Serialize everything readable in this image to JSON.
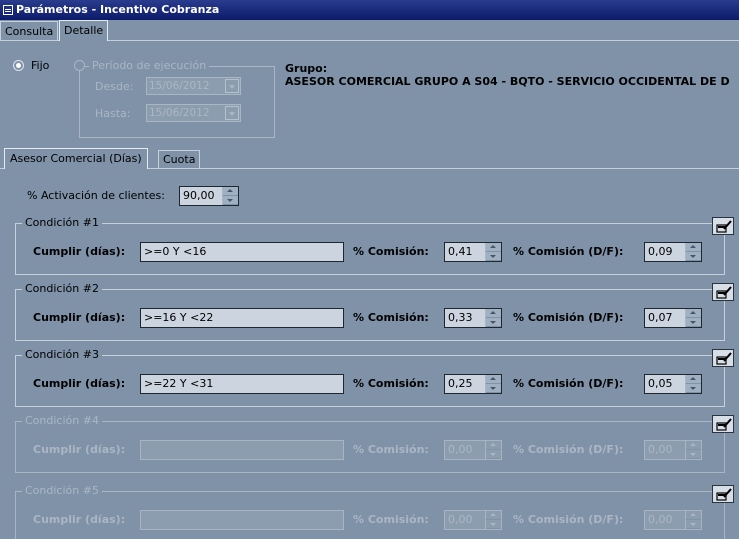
{
  "window": {
    "title": "Parámetros - Incentivo Cobranza"
  },
  "tabs": [
    {
      "label": "Consulta"
    },
    {
      "label": "Detalle"
    }
  ],
  "header": {
    "fijo_label": "Fijo",
    "periodo_label": "Período de ejecución",
    "desde_label": "Desde:",
    "desde_value": "15/06/2012",
    "hasta_label": "Hasta:",
    "hasta_value": "15/06/2012",
    "grupo_label": "Grupo:",
    "grupo_value": "ASESOR COMERCIAL GRUPO A S04 - BQTO - SERVICIO OCCIDENTAL DE D"
  },
  "subtabs": [
    {
      "label": "Asesor Comercial (Días)"
    },
    {
      "label": "Cuota"
    }
  ],
  "activacion": {
    "label": "% Activación de clientes:",
    "value": "90,00"
  },
  "field_labels": {
    "cumplir": "Cumplir (días):",
    "comision": "% Comisión:",
    "comision_df": "% Comisión (D/F):"
  },
  "conditions": [
    {
      "title": "Condición #1",
      "cumplir": ">=0 Y <16",
      "comision": "0,41",
      "comision_df": "0,09",
      "enabled": true
    },
    {
      "title": "Condición #2",
      "cumplir": ">=16 Y <22",
      "comision": "0,33",
      "comision_df": "0,07",
      "enabled": true
    },
    {
      "title": "Condición #3",
      "cumplir": ">=22 Y <31",
      "comision": "0,25",
      "comision_df": "0,05",
      "enabled": true
    },
    {
      "title": "Condición #4",
      "cumplir": "",
      "comision": "0,00",
      "comision_df": "0,00",
      "enabled": false
    },
    {
      "title": "Condición #5",
      "cumplir": "",
      "comision": "0,00",
      "comision_df": "0,00",
      "enabled": false
    }
  ],
  "colors": {
    "background": "#7f92a8",
    "titlebar": "#0c1a6a",
    "field": "#ccd5df"
  },
  "icons": {
    "edit": "edit-pencil-icon",
    "window": "window-icon"
  }
}
